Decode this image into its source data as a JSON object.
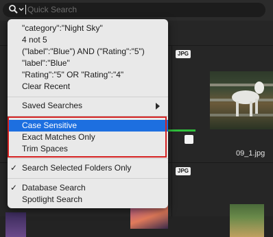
{
  "search": {
    "placeholder": "Quick Search",
    "value": ""
  },
  "menu": {
    "recent": [
      "\"category\":\"Night Sky\"",
      "4 not 5",
      "(\"label\":\"Blue\") AND (\"Rating\":\"5\")",
      "\"label\":\"Blue\"",
      "\"Rating\":\"5\" OR \"Rating\":\"4\""
    ],
    "clear_recent": "Clear Recent",
    "saved_searches": "Saved Searches",
    "case_sensitive": "Case Sensitive",
    "exact_matches_only": "Exact Matches Only",
    "trim_spaces": "Trim Spaces",
    "search_selected_folders_only": "Search Selected Folders Only",
    "database_search": "Database Search",
    "spotlight_search": "Spotlight Search",
    "checkmark": "✓"
  },
  "browser": {
    "badges": [
      "JPG",
      "JPG",
      "JPG",
      "JPG"
    ],
    "filename": "09_1.jpg"
  },
  "colors": {
    "selection": "#1d6fe0",
    "highlight_outline": "#d42020",
    "accent_bar": "#2fbf3c"
  }
}
